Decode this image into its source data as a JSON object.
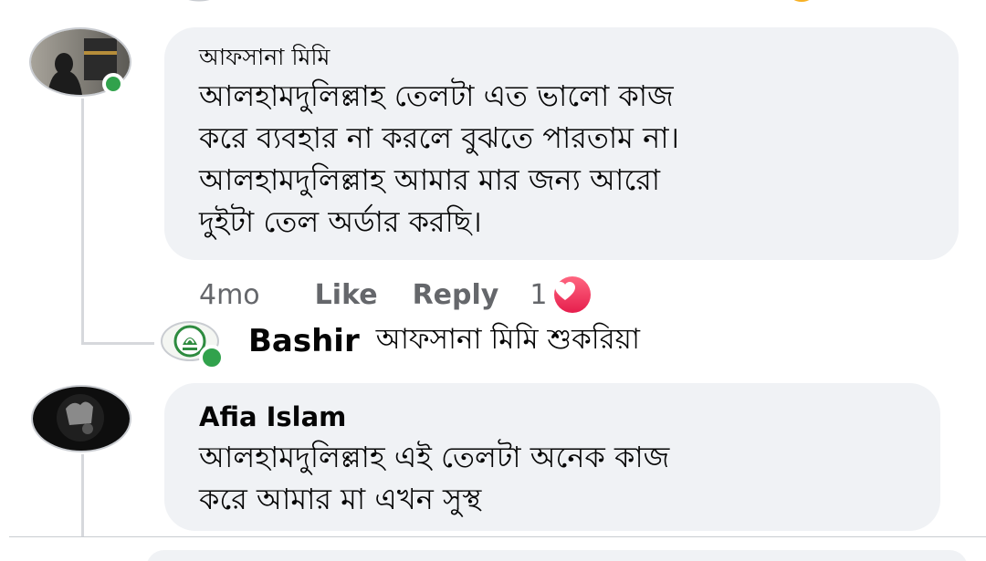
{
  "colors": {
    "bubble_bg": "#f0f2f5",
    "text": "#050505",
    "meta_text": "#65676b",
    "online": "#31a24c",
    "love": "#f33e58"
  },
  "comments": [
    {
      "author": "আফসানা মিমি",
      "text": "আলহামদুলিল্লাহ তেলটা এত ভালো  কাজ\nকরে ব্যবহার না করলে বুঝতে পারতাম না।\nআলহামদুলিল্লাহ আমার মার জন্য আরো\nদুইটা  তেল অর্ডার  করছি।",
      "avatar_icon": "profile-photo",
      "online": true,
      "actions": {
        "time": "4mo",
        "like": "Like",
        "reply": "Reply",
        "reaction_count": "1",
        "reaction_icon": "love-icon"
      },
      "reply": {
        "author": "Bashir",
        "text": "আফসানা মিমি শুকরিয়া",
        "avatar_icon": "bashir-logo"
      }
    },
    {
      "author": "Afia Islam",
      "text": "আলহামদুলিল্লাহ এই তেলটা অনেক কাজ\nকরে আমার মা এখন সুস্থ",
      "avatar_icon": "profile-photo"
    }
  ]
}
